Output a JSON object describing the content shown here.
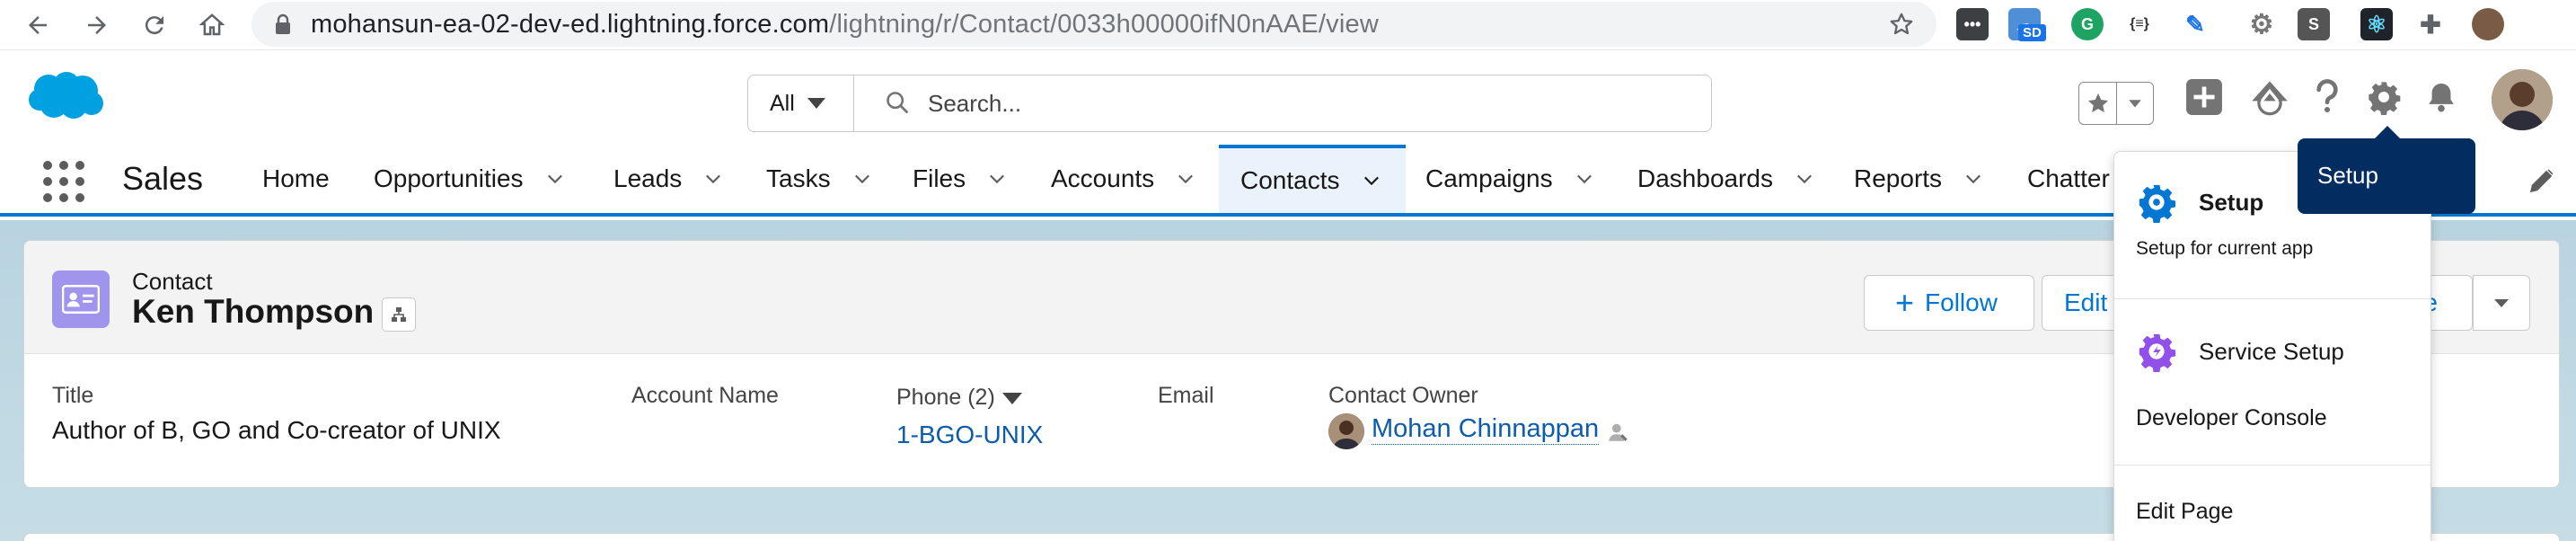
{
  "browser": {
    "url_host": "mohansun-ea-02-dev-ed.lightning.force.com",
    "url_path": "/lightning/r/Contact/0033h00000ifN0nAAE/view",
    "ext_sd_badge": "SD",
    "ext_brackets": "{≡}",
    "ext_s": "S",
    "icons": [
      "back-arrow-icon",
      "forward-arrow-icon",
      "reload-icon",
      "home-icon",
      "lock-icon",
      "bookmark-star-icon",
      "extensions-puzzle-icon"
    ]
  },
  "header": {
    "search_scope": "All",
    "search_placeholder": "Search..."
  },
  "nav": {
    "app_name": "Sales",
    "tabs": [
      {
        "label": "Home",
        "has_menu": false
      },
      {
        "label": "Opportunities",
        "has_menu": true
      },
      {
        "label": "Leads",
        "has_menu": true
      },
      {
        "label": "Tasks",
        "has_menu": true
      },
      {
        "label": "Files",
        "has_menu": true
      },
      {
        "label": "Accounts",
        "has_menu": true
      },
      {
        "label": "Contacts",
        "has_menu": true,
        "active": true
      },
      {
        "label": "Campaigns",
        "has_menu": true
      },
      {
        "label": "Dashboards",
        "has_menu": true
      },
      {
        "label": "Reports",
        "has_menu": true
      },
      {
        "label": "Chatter",
        "has_menu": false
      }
    ]
  },
  "record": {
    "type": "Contact",
    "name": "Ken Thompson",
    "buttons": {
      "follow": "Follow",
      "edit": "Edit",
      "delete_tail": "te"
    },
    "fields": {
      "title_label": "Title",
      "title_value": "Author of B, GO and Co-creator of UNIX",
      "account_label": "Account Name",
      "phone_label": "Phone (2)",
      "phone_value": "1-BGO-UNIX",
      "email_label": "Email",
      "owner_label": "Contact Owner",
      "owner_value": "Mohan Chinnappan"
    }
  },
  "setup_menu": {
    "tooltip": "Setup",
    "setup_title": "Setup",
    "setup_sub": "Setup for current app",
    "service_setup": "Service Setup",
    "developer_console": "Developer Console",
    "edit_page": "Edit Page"
  },
  "colors": {
    "brand_blue": "#0176d3",
    "link_blue": "#0b5cab",
    "contact_icon": "#a094ed",
    "tooltip_bg": "#032d60",
    "salesforce_cloud": "#00a1e0"
  }
}
